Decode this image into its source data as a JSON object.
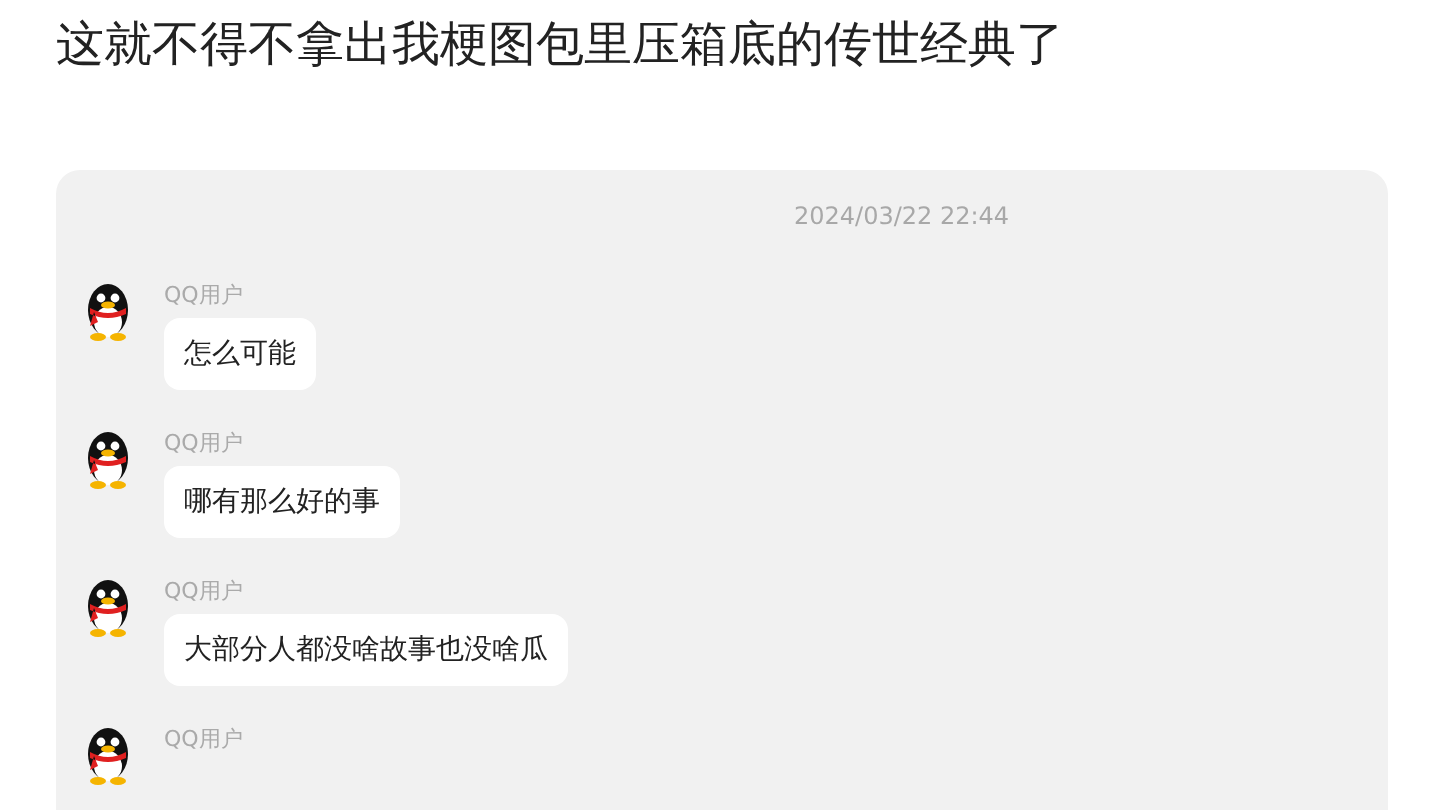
{
  "post": {
    "title": "这就不得不拿出我梗图包里压箱底的传世经典了"
  },
  "chat": {
    "timestamp": "2024/03/22 22:44",
    "messages": [
      {
        "sender": "QQ用户",
        "text": "怎么可能"
      },
      {
        "sender": "QQ用户",
        "text": "哪有那么好的事"
      },
      {
        "sender": "QQ用户",
        "text": "大部分人都没啥故事也没啥瓜"
      },
      {
        "sender": "QQ用户"
      }
    ]
  }
}
